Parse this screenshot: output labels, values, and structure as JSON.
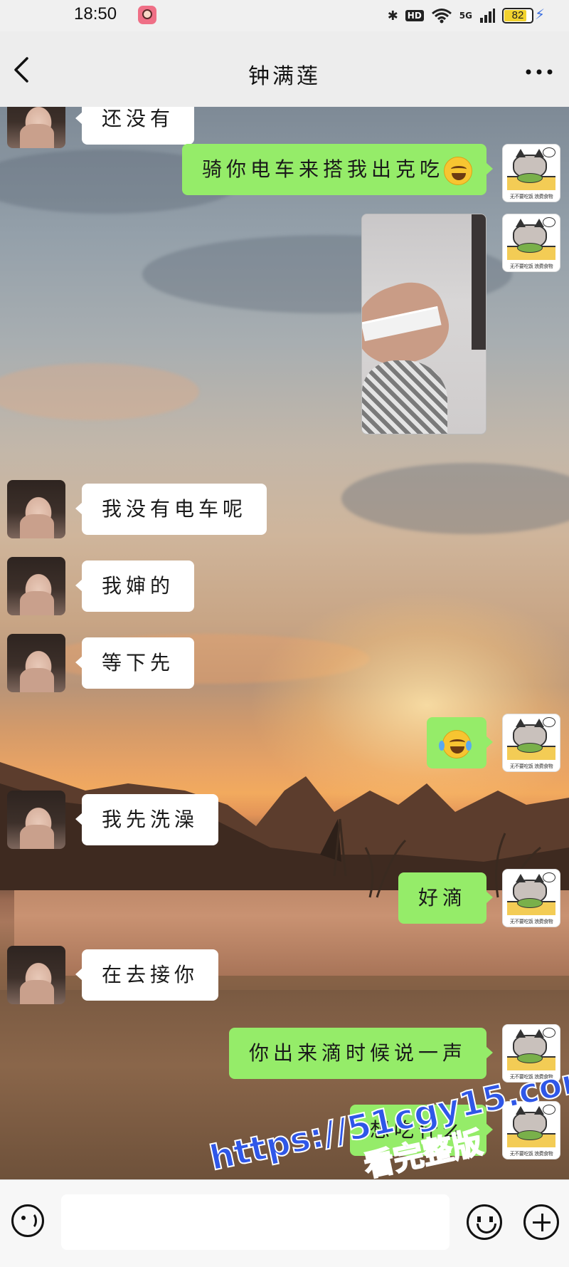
{
  "status_bar": {
    "time": "18:50",
    "bluetooth_icon": "✱",
    "hd_label": "HD",
    "wifi_icon": "wifi-icon",
    "network_label": "5G",
    "battery_level": "82",
    "battery_fraction": 0.82
  },
  "header": {
    "contact_name": "钟满莲"
  },
  "messages": [
    {
      "from": "contact",
      "text": "还没有"
    },
    {
      "from": "me",
      "text": "骑你电车来搭我出克吃"
    },
    {
      "from": "me",
      "type": "image"
    },
    {
      "from": "contact",
      "text": "我没有电车呢"
    },
    {
      "from": "contact",
      "text": "我婶的"
    },
    {
      "from": "contact",
      "text": "等下先"
    },
    {
      "from": "me",
      "type": "emoji"
    },
    {
      "from": "contact",
      "text": "我先洗澡"
    },
    {
      "from": "me",
      "text": "好滴"
    },
    {
      "from": "contact",
      "text": "在去接你"
    },
    {
      "from": "me",
      "text": "你出来滴时候说一声"
    },
    {
      "from": "me",
      "text": "想吃什么"
    }
  ],
  "avatar_caption": "无不要吃饭 浪费食物",
  "input": {
    "value": "",
    "placeholder": ""
  },
  "watermark": {
    "url": "https://51cgy15.com",
    "subtitle": "看完整版"
  },
  "colors": {
    "bubble_out": "#95ec69",
    "bubble_in": "#ffffff",
    "watermark": "#2f57e8"
  }
}
